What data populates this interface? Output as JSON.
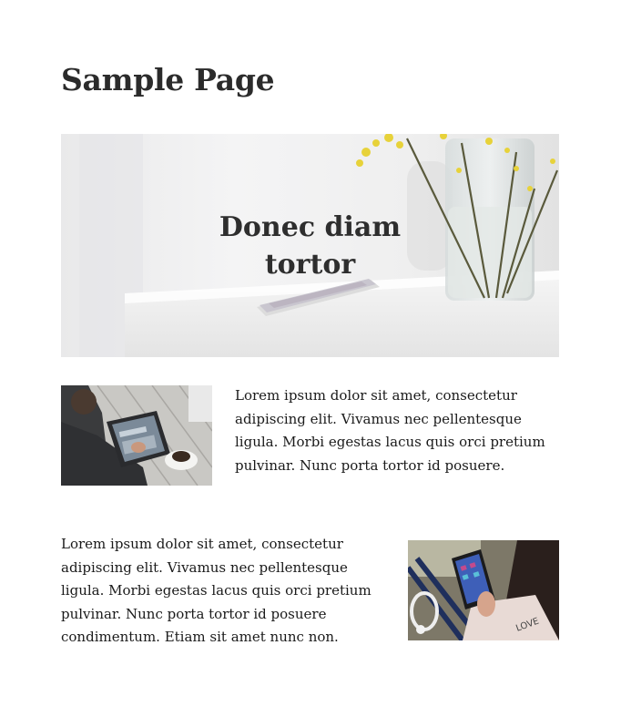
{
  "page": {
    "title": "Sample Page"
  },
  "hero": {
    "heading_line1": "Donec diam",
    "heading_line2": "tortor",
    "image": "desk-with-phone-and-flower-vase"
  },
  "media_rows": [
    {
      "image": "person-using-tablet-with-coffee",
      "text_lines": [
        "Lorem ipsum dolor sit amet, consectetur",
        "adipiscing elit. Vivamus nec pellentesque",
        "ligula. Morbi egestas lacus quis orci pretium",
        "pulvinar. Nunc porta tortor id posuere."
      ]
    },
    {
      "image": "person-holding-smartphone-with-headphones",
      "text_lines": [
        "Lorem ipsum dolor sit amet, consectetur",
        "adipiscing elit. Vivamus nec pellentesque",
        "ligula. Morbi egestas lacus quis orci pretium",
        "pulvinar. Nunc porta tortor id posuere",
        "condimentum. Etiam sit amet nunc non."
      ]
    }
  ],
  "colors": {
    "text": "#1a1a1a",
    "heading": "#2b2b2b",
    "background": "#ffffff"
  }
}
